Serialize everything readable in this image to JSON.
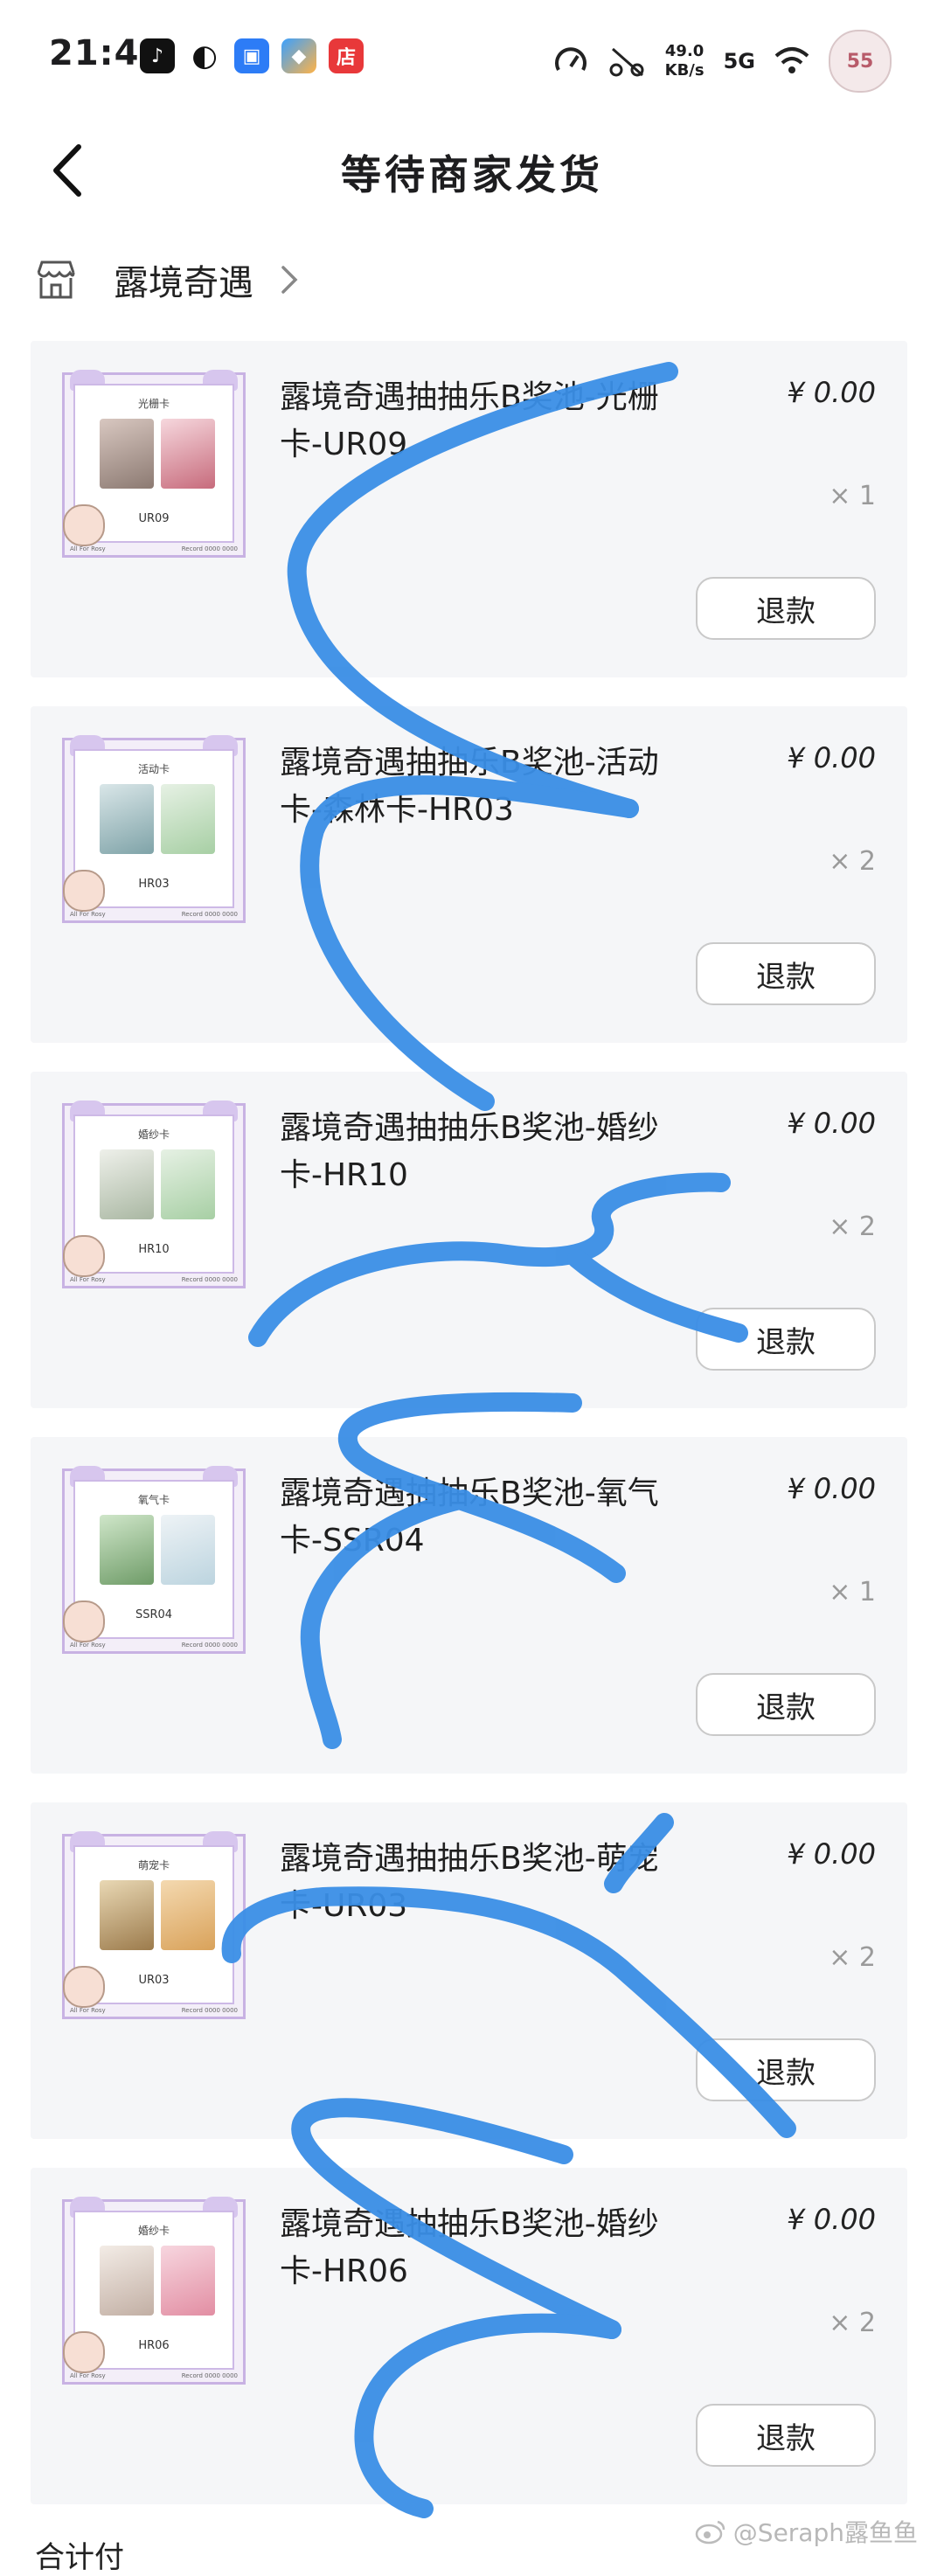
{
  "status_bar": {
    "time": "21:48",
    "net_speed_value": "49.0",
    "net_speed_unit": "KB/s",
    "network": "5G",
    "avatar_text": "55",
    "app_icons": [
      "music-app-icon",
      "flame-app-icon",
      "scan-app-icon",
      "photos-app-icon",
      "shop-app-icon"
    ],
    "shop_app_label": "店"
  },
  "header": {
    "title": "等待商家发货"
  },
  "shop": {
    "name": "露境奇遇"
  },
  "orders": [
    {
      "title": "露境奇遇抽抽乐B奖池-光栅卡-UR09",
      "price": "¥ 0.00",
      "qty": "× 1",
      "refund_label": "退款",
      "card_type": "光栅卡",
      "card_code": "UR09"
    },
    {
      "title": "露境奇遇抽抽乐B奖池-活动卡-森林卡-HR03",
      "price": "¥ 0.00",
      "qty": "× 2",
      "refund_label": "退款",
      "card_type": "活动卡",
      "card_code": "HR03"
    },
    {
      "title": "露境奇遇抽抽乐B奖池-婚纱卡-HR10",
      "price": "¥ 0.00",
      "qty": "× 2",
      "refund_label": "退款",
      "card_type": "婚纱卡",
      "card_code": "HR10"
    },
    {
      "title": "露境奇遇抽抽乐B奖池-氧气卡-SSR04",
      "price": "¥ 0.00",
      "qty": "× 1",
      "refund_label": "退款",
      "card_type": "氧气卡",
      "card_code": "SSR04"
    },
    {
      "title": "露境奇遇抽抽乐B奖池-萌宠卡-UR03",
      "price": "¥ 0.00",
      "qty": "× 2",
      "refund_label": "退款",
      "card_type": "萌宠卡",
      "card_code": "UR03"
    },
    {
      "title": "露境奇遇抽抽乐B奖池-婚纱卡-HR06",
      "price": "¥ 0.00",
      "qty": "× 2",
      "refund_label": "退款",
      "card_type": "婚纱卡",
      "card_code": "HR06"
    }
  ],
  "thumb_footer": {
    "left": "All For Rosy",
    "right": "Record 0000 0000"
  },
  "bottom": {
    "partial_text": "合计付",
    "watermark": "@Seraph露鱼鱼"
  },
  "colors": {
    "scribble": "#3a8ee6",
    "card_bg": "#f5f6f8",
    "thumb_border": "#c8b2e3"
  }
}
